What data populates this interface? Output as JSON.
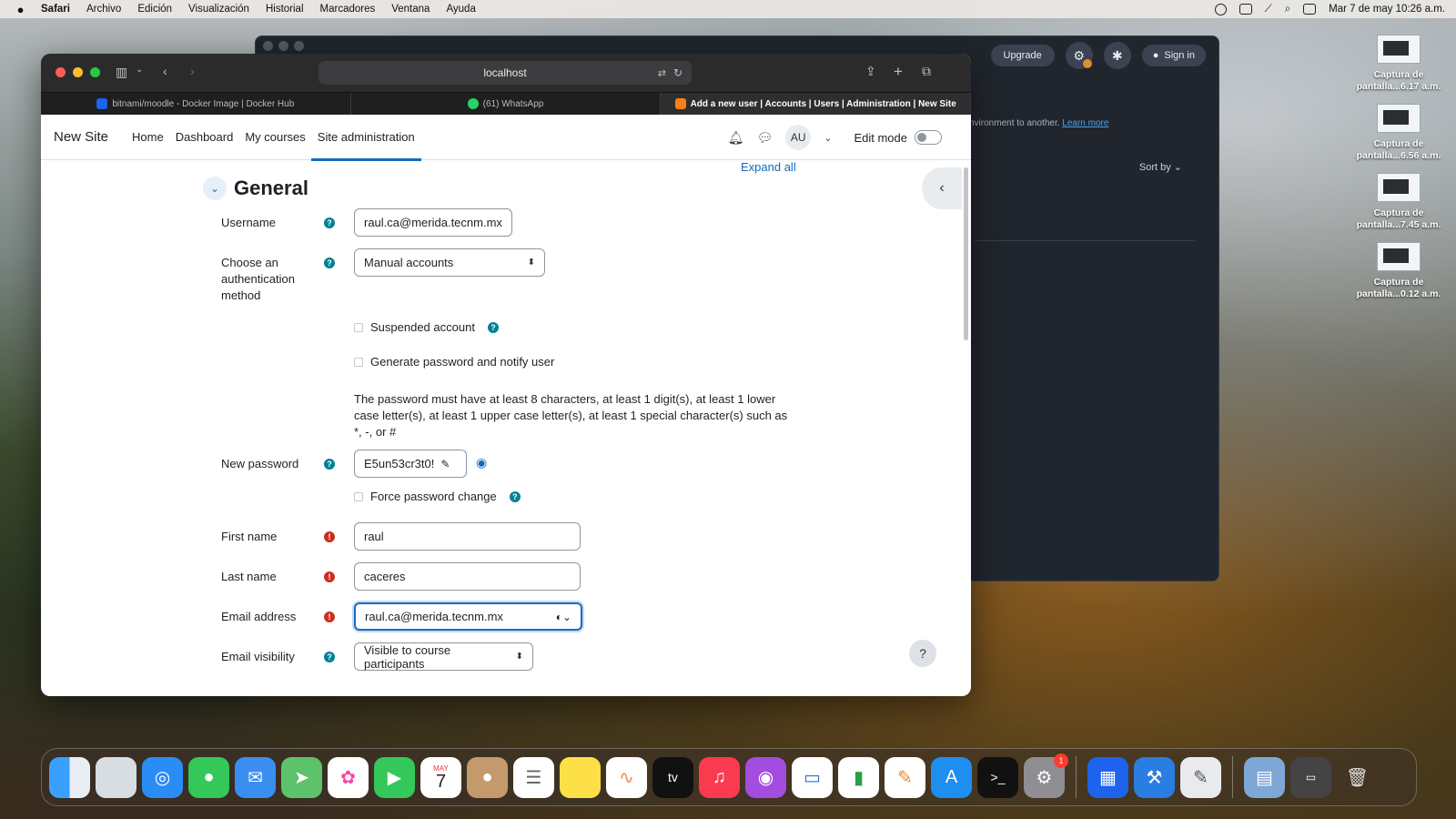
{
  "menubar": {
    "app": "Safari",
    "items": [
      "Archivo",
      "Edición",
      "Visualización",
      "Historial",
      "Marcadores",
      "Ventana",
      "Ayuda"
    ],
    "datetime": "Mar 7 de may  10:26 a.m."
  },
  "bg_window": {
    "upgrade": "Upgrade",
    "signin": "Sign in",
    "env_text": "nvironment to another.",
    "learn_more": "Learn more",
    "sort_by": "Sort by"
  },
  "desktop": {
    "items": [
      {
        "line1": "Captura de",
        "line2": "pantalla...6.17 a.m."
      },
      {
        "line1": "Captura de",
        "line2": "pantalla...6.56 a.m."
      },
      {
        "line1": "Captura de",
        "line2": "pantalla...7.45 a.m."
      },
      {
        "line1": "Captura de",
        "line2": "pantalla...0.12 a.m."
      }
    ]
  },
  "browser": {
    "url": "localhost",
    "tabs": [
      {
        "label": "bitnami/moodle - Docker Image | Docker Hub"
      },
      {
        "label": "(61) WhatsApp"
      },
      {
        "label": "Add a new user | Accounts | Users | Administration | New Site"
      }
    ]
  },
  "moodle": {
    "site_name": "New Site",
    "nav": [
      "Home",
      "Dashboard",
      "My courses",
      "Site administration"
    ],
    "avatar": "AU",
    "edit_mode": "Edit mode",
    "expand_all": "Expand all",
    "section_title": "General",
    "username_label": "Username",
    "username_value": "raul.ca@merida.tecnm.mx",
    "auth_label": "Choose an authentication method",
    "auth_value": "Manual accounts",
    "suspended_label": "Suspended account",
    "generate_label": "Generate password and notify user",
    "password_note": "The password must have at least 8 characters, at least 1 digit(s), at least 1 lower case letter(s), at least 1 upper case letter(s), at least 1 special character(s) such as *, -, or #",
    "new_password_label": "New password",
    "new_password_value": "E5un53cr3t0!",
    "force_change_label": "Force password change",
    "first_name_label": "First name",
    "first_name_value": "raul",
    "last_name_label": "Last name",
    "last_name_value": "caceres",
    "email_label": "Email address",
    "email_value": "raul.ca@merida.tecnm.mx",
    "email_vis_label": "Email visibility",
    "email_vis_value": "Visible to course participants",
    "help": "?"
  },
  "dock": {
    "calendar_month": "MAY",
    "calendar_day": "7",
    "tv": "tv",
    "settings_badge": "1"
  },
  "colors": {
    "moodle_primary": "#0f6cbf",
    "help_teal": "#008196",
    "required_red": "#ca3120"
  }
}
